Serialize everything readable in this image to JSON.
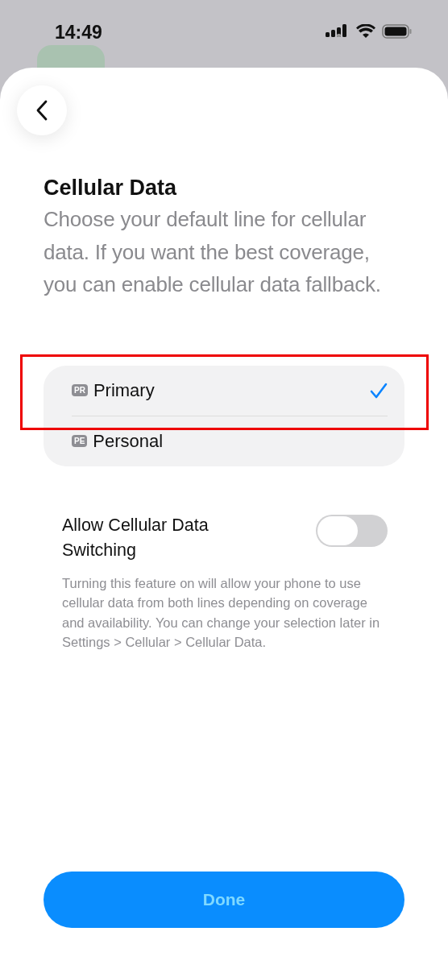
{
  "status_bar": {
    "time": "14:49"
  },
  "sheet": {
    "title": "Cellular Data",
    "subtitle": "Choose your default line for cellular data. If you want the best coverage, you can enable cellular data fallback."
  },
  "lines": [
    {
      "badge": "PR",
      "label": "Primary",
      "selected": true,
      "highlighted": true
    },
    {
      "badge": "PE",
      "label": "Personal",
      "selected": false,
      "highlighted": false
    }
  ],
  "switching": {
    "label": "Allow Cellular Data Switching",
    "on": false,
    "description": "Turning this feature on will allow your phone to use cellular data from both lines depending on coverage and availability. You can change your selection later in Settings > Cellular > Cellular Data."
  },
  "done_button": {
    "label": "Done"
  }
}
